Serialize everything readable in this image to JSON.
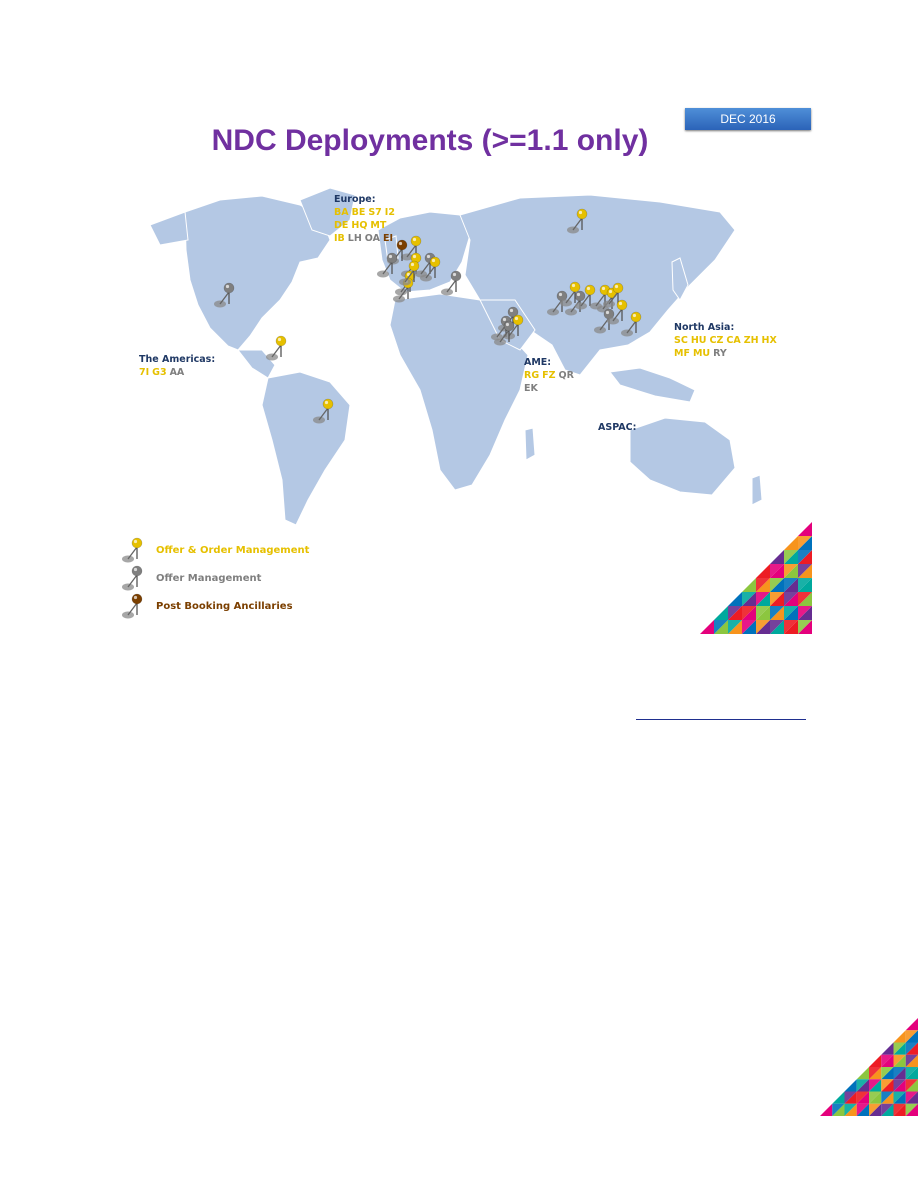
{
  "date_badge": "DEC 2016",
  "title": "NDC Deployments (>=1.1 only)",
  "colors": {
    "oom": "#e6c000",
    "om": "#7f7f7f",
    "pba": "#7b3f00",
    "region_title": "#1f3864",
    "title": "#7030a0",
    "land": "#b4c8e4"
  },
  "regions": {
    "europe": {
      "title": "Europe:",
      "rows": [
        [
          {
            "code": "BA",
            "status": "oom"
          },
          {
            "code": "BE",
            "status": "oom"
          },
          {
            "code": "S7",
            "status": "oom"
          },
          {
            "code": "I2",
            "status": "oom"
          }
        ],
        [
          {
            "code": "DE",
            "status": "oom"
          },
          {
            "code": "HQ",
            "status": "oom"
          },
          {
            "code": "MT",
            "status": "oom"
          }
        ],
        [
          {
            "code": "IB",
            "status": "oom"
          },
          {
            "code": "LH",
            "status": "om"
          },
          {
            "code": "OA",
            "status": "om"
          },
          {
            "code": "EI",
            "status": "pba"
          }
        ]
      ]
    },
    "americas": {
      "title": "The Americas:",
      "rows": [
        [
          {
            "code": "7I",
            "status": "oom"
          },
          {
            "code": "G3",
            "status": "oom"
          },
          {
            "code": "AA",
            "status": "om"
          }
        ]
      ]
    },
    "ame": {
      "title": "AME:",
      "rows": [
        [
          {
            "code": "RG",
            "status": "oom"
          },
          {
            "code": "FZ",
            "status": "oom"
          },
          {
            "code": "QR",
            "status": "om"
          }
        ],
        [
          {
            "code": "EK",
            "status": "om"
          }
        ]
      ]
    },
    "north_asia": {
      "title": "North Asia:",
      "rows": [
        [
          {
            "code": "SC",
            "status": "oom"
          },
          {
            "code": "HU",
            "status": "oom"
          },
          {
            "code": "CZ",
            "status": "oom"
          },
          {
            "code": "CA",
            "status": "oom"
          },
          {
            "code": "ZH",
            "status": "oom"
          },
          {
            "code": "HX",
            "status": "oom"
          }
        ],
        [
          {
            "code": "MF",
            "status": "oom"
          },
          {
            "code": "MU",
            "status": "oom"
          },
          {
            "code": "RY",
            "status": "om"
          }
        ]
      ]
    },
    "aspac": {
      "title": "ASPAC:",
      "rows": []
    }
  },
  "legend": [
    {
      "label": "Offer & Order Management",
      "status": "oom"
    },
    {
      "label": "Offer Management",
      "status": "om"
    },
    {
      "label": "Post Booking Ancillaries",
      "status": "pba"
    }
  ],
  "pins": [
    {
      "status": "om",
      "region": "americas"
    },
    {
      "status": "oom",
      "region": "americas"
    },
    {
      "status": "oom",
      "region": "americas"
    },
    {
      "status": "oom",
      "region": "europe"
    },
    {
      "status": "pba",
      "region": "europe"
    },
    {
      "status": "om",
      "region": "europe"
    },
    {
      "status": "oom",
      "region": "europe"
    },
    {
      "status": "om",
      "region": "europe"
    },
    {
      "status": "oom",
      "region": "europe"
    },
    {
      "status": "oom",
      "region": "europe"
    },
    {
      "status": "oom",
      "region": "europe"
    },
    {
      "status": "om",
      "region": "europe"
    },
    {
      "status": "oom",
      "region": "europe"
    },
    {
      "status": "om",
      "region": "ame"
    },
    {
      "status": "om",
      "region": "ame"
    },
    {
      "status": "oom",
      "region": "ame"
    },
    {
      "status": "om",
      "region": "ame"
    },
    {
      "status": "oom",
      "region": "north_asia"
    },
    {
      "status": "om",
      "region": "north_asia"
    },
    {
      "status": "om",
      "region": "north_asia"
    },
    {
      "status": "oom",
      "region": "north_asia"
    },
    {
      "status": "oom",
      "region": "north_asia"
    },
    {
      "status": "oom",
      "region": "north_asia"
    },
    {
      "status": "oom",
      "region": "north_asia"
    },
    {
      "status": "oom",
      "region": "north_asia"
    },
    {
      "status": "om",
      "region": "north_asia"
    },
    {
      "status": "oom",
      "region": "north_asia"
    },
    {
      "status": "oom",
      "region": "north_asia"
    }
  ]
}
